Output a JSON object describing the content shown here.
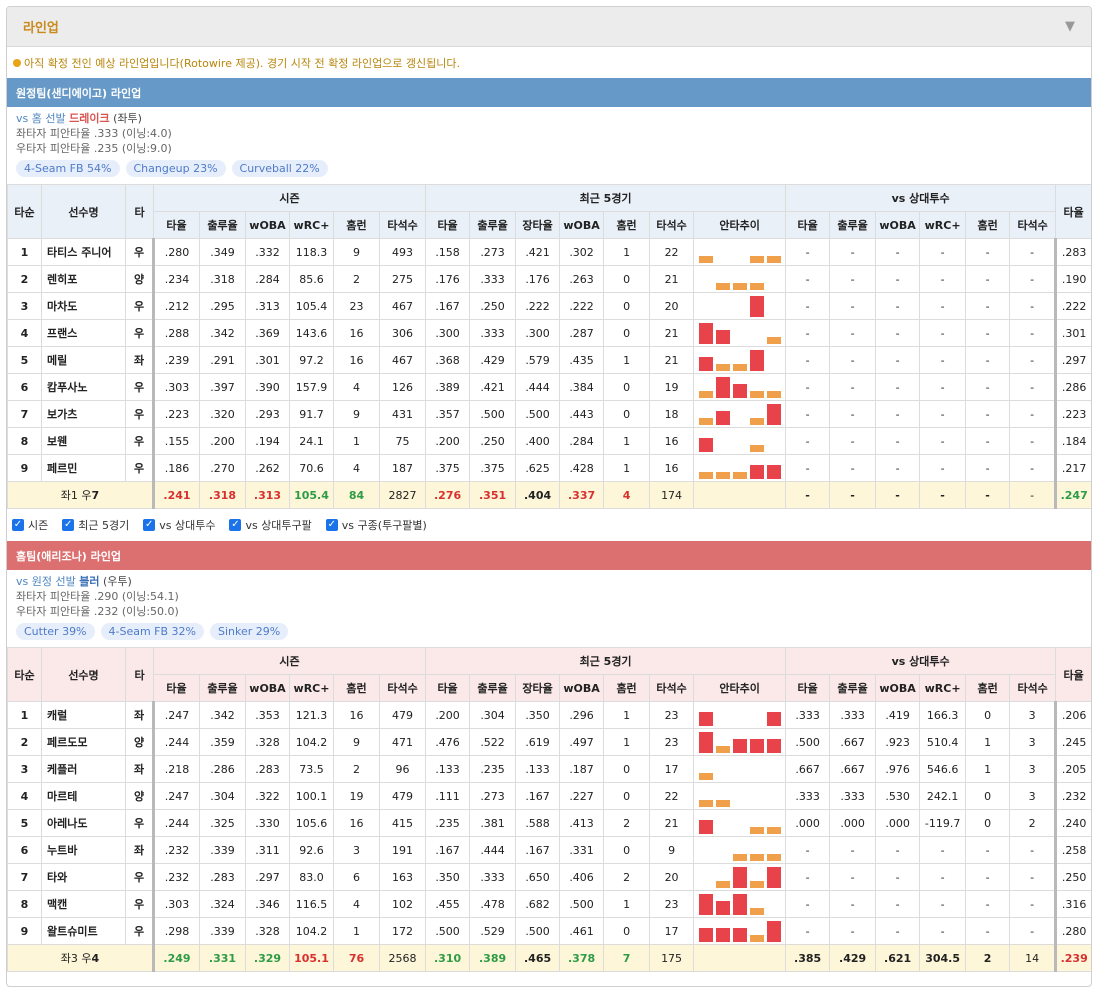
{
  "header": {
    "title": "라인업"
  },
  "notice": "아직 확정 전인 예상 라인업입니다(Rotowire 제공). 경기 시작 전 확정 라인업으로 갱신됩니다.",
  "columns": {
    "order": "타순",
    "name": "선수명",
    "hand": "타",
    "group_season": "시즌",
    "group_recent": "최근 5경기",
    "group_vs": "vs 상대투수",
    "avg": "타율",
    "obp": "출루율",
    "slg": "장타율",
    "woba": "wOBA",
    "wrc": "wRC+",
    "hr": "홈런",
    "ab": "타석수",
    "trend": "안타추이"
  },
  "colors": {
    "orange": "#f0a04b",
    "red": "#e8424b"
  },
  "away": {
    "title": "원정팀(샌디에이고) 라인업",
    "pitcher_vs": "vs 홈 선발",
    "pitcher": "드레이크",
    "pitcher_hand": "좌투",
    "lhb": "좌타자 피안타율 .333 (이닝:4.0)",
    "rhb": "우타자 피안타율 .235 (이닝:9.0)",
    "pitches": [
      "4-Seam FB 54%",
      "Changeup 23%",
      "Curveball 22%"
    ],
    "rows": [
      {
        "n": "1",
        "name": "타티스 주니어",
        "h": "우",
        "s": [
          ".280",
          ".349",
          ".332",
          "118.3",
          "9",
          "493"
        ],
        "r": [
          ".158",
          ".273",
          ".421",
          ".302",
          "1",
          "22"
        ],
        "trend": [
          1,
          0,
          0,
          1,
          1
        ],
        "v": [
          "-",
          "-",
          "-",
          "-",
          "-",
          "-"
        ],
        "x": ".283"
      },
      {
        "n": "2",
        "name": "렌히포",
        "h": "양",
        "s": [
          ".234",
          ".318",
          ".284",
          "85.6",
          "2",
          "275"
        ],
        "r": [
          ".176",
          ".333",
          ".176",
          ".263",
          "0",
          "21"
        ],
        "trend": [
          0,
          1,
          1,
          1,
          0
        ],
        "v": [
          "-",
          "-",
          "-",
          "-",
          "-",
          "-"
        ],
        "x": ".190"
      },
      {
        "n": "3",
        "name": "마차도",
        "h": "우",
        "s": [
          ".212",
          ".295",
          ".313",
          "105.4",
          "23",
          "467"
        ],
        "r": [
          ".167",
          ".250",
          ".222",
          ".222",
          "0",
          "20"
        ],
        "trend": [
          0,
          0,
          0,
          3,
          0
        ],
        "v": [
          "-",
          "-",
          "-",
          "-",
          "-",
          "-"
        ],
        "x": ".222"
      },
      {
        "n": "4",
        "name": "프랜스",
        "h": "우",
        "s": [
          ".288",
          ".342",
          ".369",
          "143.6",
          "16",
          "306"
        ],
        "r": [
          ".300",
          ".333",
          ".300",
          ".287",
          "0",
          "21"
        ],
        "trend": [
          3,
          2,
          0,
          0,
          1
        ],
        "v": [
          "-",
          "-",
          "-",
          "-",
          "-",
          "-"
        ],
        "x": ".301"
      },
      {
        "n": "5",
        "name": "메릴",
        "h": "좌",
        "s": [
          ".239",
          ".291",
          ".301",
          "97.2",
          "16",
          "467"
        ],
        "r": [
          ".368",
          ".429",
          ".579",
          ".435",
          "1",
          "21"
        ],
        "trend": [
          2,
          1,
          1,
          3,
          0
        ],
        "v": [
          "-",
          "-",
          "-",
          "-",
          "-",
          "-"
        ],
        "x": ".297"
      },
      {
        "n": "6",
        "name": "캄푸사노",
        "h": "우",
        "s": [
          ".303",
          ".397",
          ".390",
          "157.9",
          "4",
          "126"
        ],
        "r": [
          ".389",
          ".421",
          ".444",
          ".384",
          "0",
          "19"
        ],
        "trend": [
          1,
          3,
          2,
          1,
          1
        ],
        "v": [
          "-",
          "-",
          "-",
          "-",
          "-",
          "-"
        ],
        "x": ".286"
      },
      {
        "n": "7",
        "name": "보가츠",
        "h": "우",
        "s": [
          ".223",
          ".320",
          ".293",
          "91.7",
          "9",
          "431"
        ],
        "r": [
          ".357",
          ".500",
          ".500",
          ".443",
          "0",
          "18"
        ],
        "trend": [
          1,
          2,
          0,
          1,
          3
        ],
        "v": [
          "-",
          "-",
          "-",
          "-",
          "-",
          "-"
        ],
        "x": ".223"
      },
      {
        "n": "8",
        "name": "보웬",
        "h": "우",
        "s": [
          ".155",
          ".200",
          ".194",
          "24.1",
          "1",
          "75"
        ],
        "r": [
          ".200",
          ".250",
          ".400",
          ".284",
          "1",
          "16"
        ],
        "trend": [
          2,
          0,
          0,
          1,
          0
        ],
        "v": [
          "-",
          "-",
          "-",
          "-",
          "-",
          "-"
        ],
        "x": ".184"
      },
      {
        "n": "9",
        "name": "페르민",
        "h": "우",
        "s": [
          ".186",
          ".270",
          ".262",
          "70.6",
          "4",
          "187"
        ],
        "r": [
          ".375",
          ".375",
          ".625",
          ".428",
          "1",
          "16"
        ],
        "trend": [
          1,
          1,
          1,
          2,
          2
        ],
        "v": [
          "-",
          "-",
          "-",
          "-",
          "-",
          "-"
        ],
        "x": ".217"
      }
    ],
    "total": {
      "label_pre": "좌1 우",
      "label_num": "7",
      "s": [
        ".241",
        ".318",
        ".313",
        "105.4",
        "84",
        "2827"
      ],
      "r": [
        ".276",
        ".351",
        ".404",
        ".337",
        "4",
        "174"
      ],
      "v": [
        "-",
        "-",
        "-",
        "-",
        "-",
        "-"
      ],
      "x": ".247"
    }
  },
  "checks": [
    "시즌",
    "최근 5경기",
    "vs 상대투수",
    "vs 상대투구팔",
    "vs 구종(투구팔별)"
  ],
  "home": {
    "title": "홈팀(애리조나) 라인업",
    "pitcher_vs": "vs 원정 선발",
    "pitcher": "블러",
    "pitcher_hand": "우투",
    "lhb": "좌타자 피안타율 .290 (이닝:54.1)",
    "rhb": "우타자 피안타율 .232 (이닝:50.0)",
    "pitches": [
      "Cutter 39%",
      "4-Seam FB 32%",
      "Sinker 29%"
    ],
    "rows": [
      {
        "n": "1",
        "name": "캐럴",
        "h": "좌",
        "s": [
          ".247",
          ".342",
          ".353",
          "121.3",
          "16",
          "479"
        ],
        "r": [
          ".200",
          ".304",
          ".350",
          ".296",
          "1",
          "23"
        ],
        "trend": [
          2,
          0,
          0,
          0,
          2
        ],
        "v": [
          ".333",
          ".333",
          ".419",
          "166.3",
          "0",
          "3"
        ],
        "x": ".206"
      },
      {
        "n": "2",
        "name": "페르도모",
        "h": "양",
        "s": [
          ".244",
          ".359",
          ".328",
          "104.2",
          "9",
          "471"
        ],
        "r": [
          ".476",
          ".522",
          ".619",
          ".497",
          "1",
          "23"
        ],
        "trend": [
          3,
          1,
          2,
          2,
          2
        ],
        "v": [
          ".500",
          ".667",
          ".923",
          "510.4",
          "1",
          "3"
        ],
        "x": ".245"
      },
      {
        "n": "3",
        "name": "케플러",
        "h": "좌",
        "s": [
          ".218",
          ".286",
          ".283",
          "73.5",
          "2",
          "96"
        ],
        "r": [
          ".133",
          ".235",
          ".133",
          ".187",
          "0",
          "17"
        ],
        "trend": [
          1,
          0,
          0,
          0,
          0
        ],
        "v": [
          ".667",
          ".667",
          ".976",
          "546.6",
          "1",
          "3"
        ],
        "x": ".205"
      },
      {
        "n": "4",
        "name": "마르테",
        "h": "양",
        "s": [
          ".247",
          ".304",
          ".322",
          "100.1",
          "19",
          "479"
        ],
        "r": [
          ".111",
          ".273",
          ".167",
          ".227",
          "0",
          "22"
        ],
        "trend": [
          1,
          1,
          0,
          0,
          0
        ],
        "v": [
          ".333",
          ".333",
          ".530",
          "242.1",
          "0",
          "3"
        ],
        "x": ".232"
      },
      {
        "n": "5",
        "name": "아레나도",
        "h": "우",
        "s": [
          ".244",
          ".325",
          ".330",
          "105.6",
          "16",
          "415"
        ],
        "r": [
          ".235",
          ".381",
          ".588",
          ".413",
          "2",
          "21"
        ],
        "trend": [
          2,
          0,
          0,
          1,
          1
        ],
        "v": [
          ".000",
          ".000",
          ".000",
          "-119.7",
          "0",
          "2"
        ],
        "x": ".240"
      },
      {
        "n": "6",
        "name": "누트바",
        "h": "좌",
        "s": [
          ".232",
          ".339",
          ".311",
          "92.6",
          "3",
          "191"
        ],
        "r": [
          ".167",
          ".444",
          ".167",
          ".331",
          "0",
          "9"
        ],
        "trend": [
          0,
          0,
          1,
          1,
          1
        ],
        "v": [
          "-",
          "-",
          "-",
          "-",
          "-",
          "-"
        ],
        "x": ".258"
      },
      {
        "n": "7",
        "name": "타와",
        "h": "우",
        "s": [
          ".232",
          ".283",
          ".297",
          "83.0",
          "6",
          "163"
        ],
        "r": [
          ".350",
          ".333",
          ".650",
          ".406",
          "2",
          "20"
        ],
        "trend": [
          0,
          1,
          3,
          1,
          3
        ],
        "v": [
          "-",
          "-",
          "-",
          "-",
          "-",
          "-"
        ],
        "x": ".250"
      },
      {
        "n": "8",
        "name": "맥캔",
        "h": "우",
        "s": [
          ".303",
          ".324",
          ".346",
          "116.5",
          "4",
          "102"
        ],
        "r": [
          ".455",
          ".478",
          ".682",
          ".500",
          "1",
          "23"
        ],
        "trend": [
          3,
          2,
          3,
          1,
          0
        ],
        "v": [
          "-",
          "-",
          "-",
          "-",
          "-",
          "-"
        ],
        "x": ".316"
      },
      {
        "n": "9",
        "name": "왈트슈미트",
        "h": "우",
        "s": [
          ".298",
          ".339",
          ".328",
          "104.2",
          "1",
          "172"
        ],
        "r": [
          ".500",
          ".529",
          ".500",
          ".461",
          "0",
          "17"
        ],
        "trend": [
          2,
          2,
          2,
          1,
          3
        ],
        "v": [
          "-",
          "-",
          "-",
          "-",
          "-",
          "-"
        ],
        "x": ".280"
      }
    ],
    "total": {
      "label_pre": "좌3 우",
      "label_num": "4",
      "s": [
        ".249",
        ".331",
        ".329",
        "105.1",
        "76",
        "2568"
      ],
      "r": [
        ".310",
        ".389",
        ".465",
        ".378",
        "7",
        "175"
      ],
      "v": [
        ".385",
        ".429",
        ".621",
        "304.5",
        "2",
        "14"
      ],
      "x": ".239"
    }
  }
}
